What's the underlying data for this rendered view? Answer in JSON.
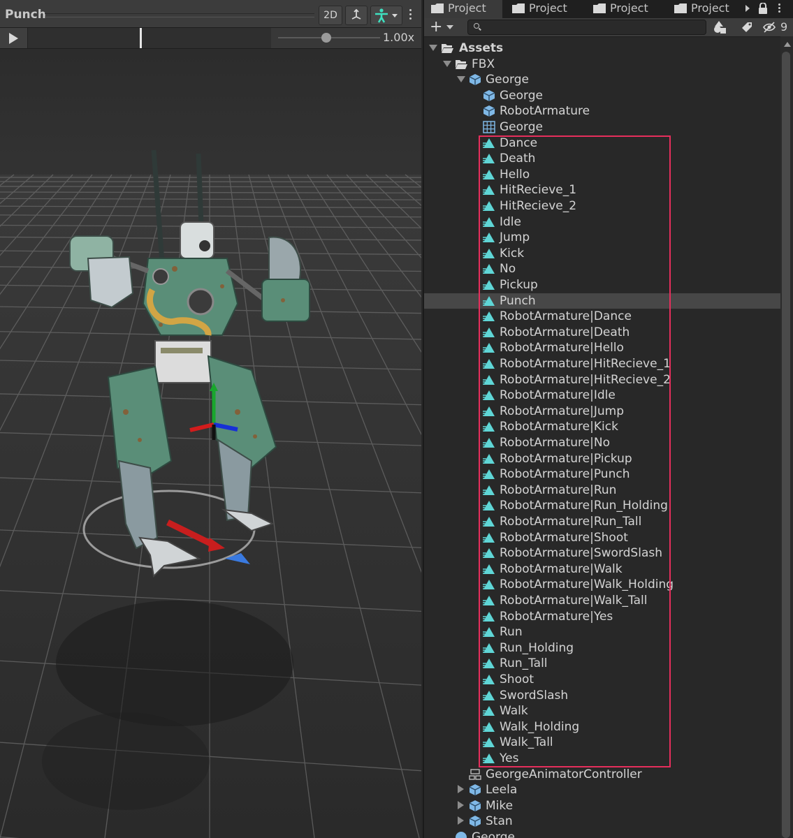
{
  "preview": {
    "clip_name": "Punch",
    "btn_2d": "2D",
    "speed": "1.00x"
  },
  "project": {
    "tabs": [
      {
        "label": "Project"
      },
      {
        "label": "Project"
      },
      {
        "label": "Project"
      },
      {
        "label": "Project"
      }
    ],
    "hidden_packages_count": "9",
    "search_value": "",
    "tree": {
      "assets": "Assets",
      "fbx": "FBX",
      "george_prefab": "George",
      "george_child_mesh": "George",
      "robot_armature": "RobotArmature",
      "george_avatar": "George",
      "animations": [
        "Dance",
        "Death",
        "Hello",
        "HitRecieve_1",
        "HitRecieve_2",
        "Idle",
        "Jump",
        "Kick",
        "No",
        "Pickup",
        "Punch",
        "RobotArmature|Dance",
        "RobotArmature|Death",
        "RobotArmature|Hello",
        "RobotArmature|HitRecieve_1",
        "RobotArmature|HitRecieve_2",
        "RobotArmature|Idle",
        "RobotArmature|Jump",
        "RobotArmature|Kick",
        "RobotArmature|No",
        "RobotArmature|Pickup",
        "RobotArmature|Punch",
        "RobotArmature|Run",
        "RobotArmature|Run_Holding",
        "RobotArmature|Run_Tall",
        "RobotArmature|Shoot",
        "RobotArmature|SwordSlash",
        "RobotArmature|Walk",
        "RobotArmature|Walk_Holding",
        "RobotArmature|Walk_Tall",
        "RobotArmature|Yes",
        "Run",
        "Run_Holding",
        "Run_Tall",
        "Shoot",
        "SwordSlash",
        "Walk",
        "Walk_Holding",
        "Walk_Tall",
        "Yes"
      ],
      "selected_animation": "Punch",
      "controller": "GeorgeAnimatorController",
      "siblings": [
        "Leela",
        "Mike",
        "Stan"
      ],
      "partial_last": "George"
    }
  },
  "colors": {
    "highlight_box": "#e62e5c",
    "anim_icon": "#5fd6d6",
    "prefab_icon": "#7fb8e6"
  }
}
